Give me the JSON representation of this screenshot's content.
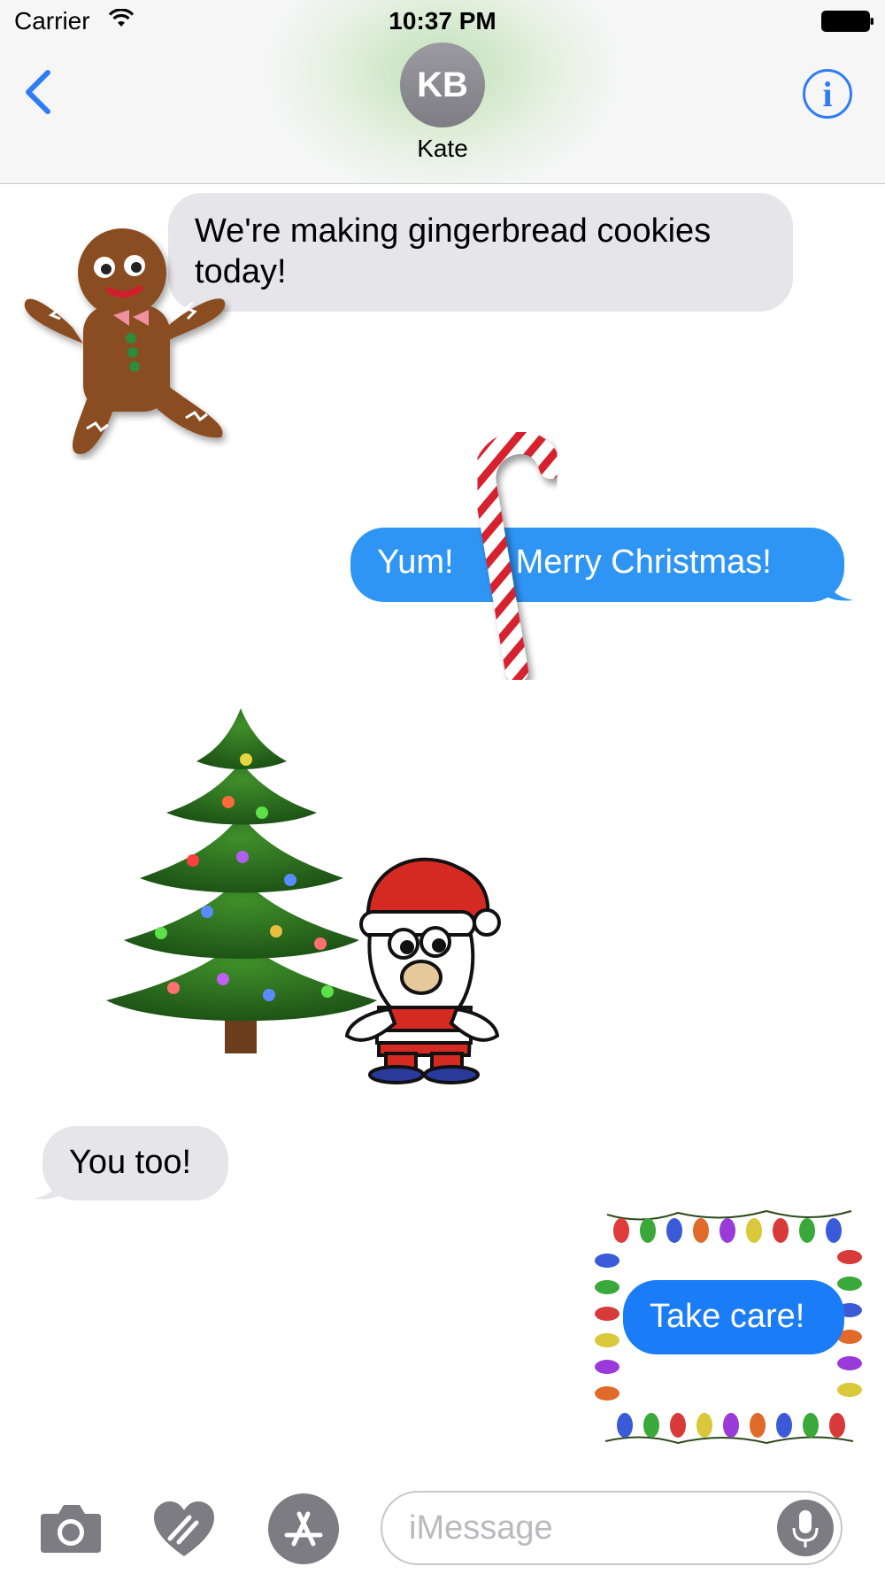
{
  "status_bar": {
    "carrier": "Carrier",
    "time": "10:37 PM"
  },
  "header": {
    "back_icon": "chevron-left-icon",
    "avatar_initials": "KB",
    "contact_name": "Kate",
    "info_icon": "info-icon",
    "info_glyph": "i",
    "accent_color": "#2f7cf6"
  },
  "messages": [
    {
      "direction": "incoming",
      "text": "We're making gingerbread cookies today!"
    },
    {
      "direction": "outgoing",
      "text_left": "Yum!",
      "text_right": "Merry Christmas!"
    },
    {
      "direction": "incoming",
      "text": "You too!"
    },
    {
      "direction": "outgoing",
      "text": "Take care!"
    }
  ],
  "stickers": [
    {
      "name": "gingerbread-man-sticker"
    },
    {
      "name": "candy-cane-sticker"
    },
    {
      "name": "christmas-tree-sticker"
    },
    {
      "name": "santa-sticker"
    },
    {
      "name": "christmas-lights-frame-sticker"
    }
  ],
  "input_bar": {
    "camera_icon": "camera-icon",
    "digital_touch_icon": "heart-touch-icon",
    "app_store_icon": "app-store-icon",
    "placeholder": "iMessage",
    "mic_icon": "microphone-icon"
  },
  "colors": {
    "incoming_bubble": "#e5e5ea",
    "outgoing_bubble": "#2f95f5",
    "outgoing_bubble_last": "#1a7cf6"
  }
}
